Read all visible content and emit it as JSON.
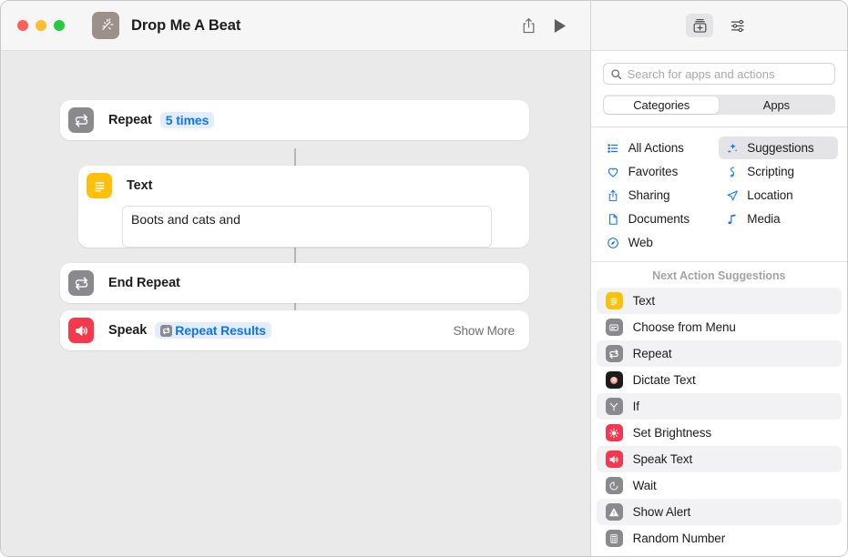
{
  "window": {
    "title": "Drop Me A Beat",
    "shortcut_icon": "magic-wand-icon",
    "icon_bg": "#9c9189",
    "traffic_lights": [
      "close",
      "minimize",
      "zoom"
    ]
  },
  "toolbar": {
    "share_label": "Share",
    "share_icon": "share-icon",
    "play_label": "Play",
    "play_icon": "play-icon"
  },
  "workflow": {
    "actions": [
      {
        "id": "repeat",
        "label": "Repeat",
        "icon": "repeat-icon",
        "icon_bg": "#8a8a8e",
        "token": "5 times"
      },
      {
        "id": "text",
        "label": "Text",
        "icon": "text-icon",
        "icon_bg": "#ffc107",
        "value": "Boots and cats and"
      },
      {
        "id": "end-repeat",
        "label": "End Repeat",
        "icon": "repeat-icon",
        "icon_bg": "#8a8a8e"
      },
      {
        "id": "speak",
        "label": "Speak",
        "icon": "speaker-icon",
        "icon_bg": "#f6384e",
        "token": "Repeat Results",
        "token_icon": "repeat-icon",
        "show_more": "Show More"
      }
    ]
  },
  "library": {
    "toolbar": {
      "action_library_label": "Action Library",
      "action_library_icon": "add-action-icon",
      "settings_label": "Shortcut Details",
      "settings_icon": "sliders-icon"
    },
    "search": {
      "placeholder": "Search for apps and actions",
      "value": "",
      "icon": "search-icon"
    },
    "segmented": {
      "options": [
        "Categories",
        "Apps"
      ],
      "selected": "Categories"
    },
    "categories": {
      "left": [
        {
          "label": "All Actions",
          "icon": "list-icon"
        },
        {
          "label": "Favorites",
          "icon": "heart-icon"
        },
        {
          "label": "Sharing",
          "icon": "share-icon"
        },
        {
          "label": "Documents",
          "icon": "document-icon"
        },
        {
          "label": "Web",
          "icon": "compass-icon"
        }
      ],
      "right": [
        {
          "label": "Suggestions",
          "icon": "sparkle-icon",
          "selected": true
        },
        {
          "label": "Scripting",
          "icon": "scripting-icon"
        },
        {
          "label": "Location",
          "icon": "location-icon"
        },
        {
          "label": "Media",
          "icon": "music-note-icon"
        }
      ],
      "accent": "#0b76f5"
    },
    "suggestions": {
      "header": "Next Action Suggestions",
      "items": [
        {
          "label": "Text",
          "icon": "text-icon",
          "icon_bg": "#ffc107"
        },
        {
          "label": "Choose from Menu",
          "icon": "menu-icon",
          "icon_bg": "#8a8a8e"
        },
        {
          "label": "Repeat",
          "icon": "repeat-icon",
          "icon_bg": "#8a8a8e"
        },
        {
          "label": "Dictate Text",
          "icon": "dictate-icon",
          "icon_bg": "#1c1c1e"
        },
        {
          "label": "If",
          "icon": "branch-icon",
          "icon_bg": "#8a8a8e"
        },
        {
          "label": "Set Brightness",
          "icon": "brightness-icon",
          "icon_bg": "#f6384e"
        },
        {
          "label": "Speak Text",
          "icon": "speaker-icon",
          "icon_bg": "#f6384e"
        },
        {
          "label": "Wait",
          "icon": "timer-icon",
          "icon_bg": "#8a8a8e"
        },
        {
          "label": "Show Alert",
          "icon": "alert-icon",
          "icon_bg": "#8a8a8e"
        },
        {
          "label": "Random Number",
          "icon": "calculator-icon",
          "icon_bg": "#8a8a8e"
        }
      ]
    }
  }
}
